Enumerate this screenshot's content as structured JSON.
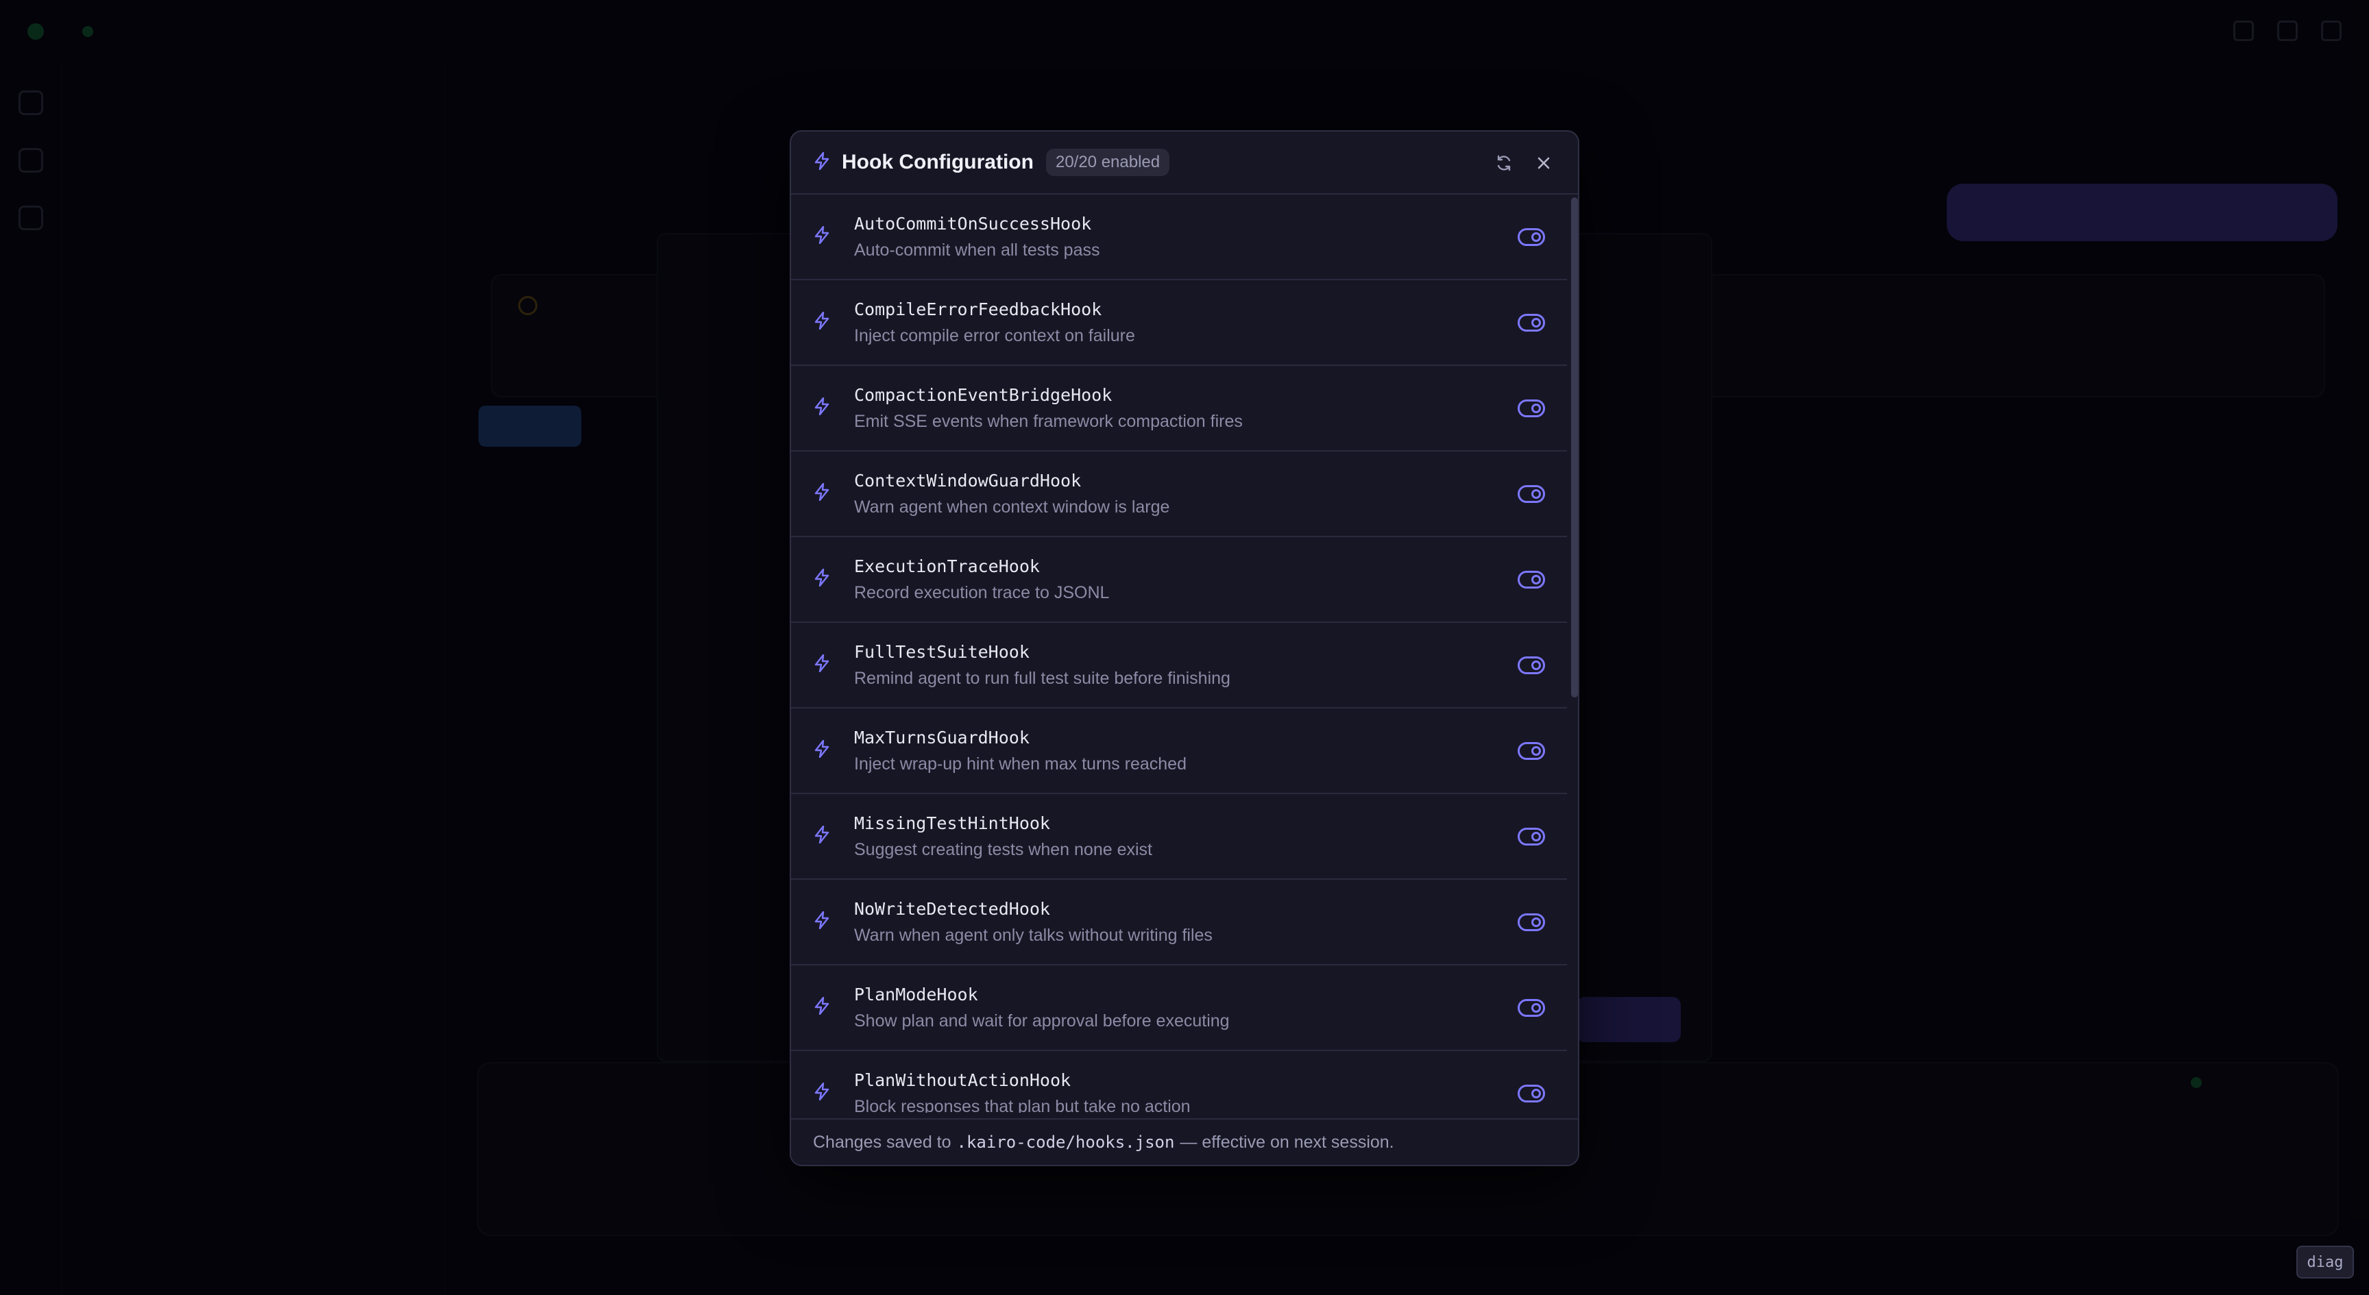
{
  "background": {
    "app_name": "",
    "explorer_title": "",
    "files": []
  },
  "modal": {
    "title": "Hook Configuration",
    "count_badge": "20/20 enabled",
    "refresh_icon": "refresh-icon",
    "close_icon": "close-icon",
    "hooks": [
      {
        "name": "AutoCommitOnSuccessHook",
        "description": "Auto-commit when all tests pass",
        "enabled": true
      },
      {
        "name": "CompileErrorFeedbackHook",
        "description": "Inject compile error context on failure",
        "enabled": true
      },
      {
        "name": "CompactionEventBridgeHook",
        "description": "Emit SSE events when framework compaction fires",
        "enabled": true
      },
      {
        "name": "ContextWindowGuardHook",
        "description": "Warn agent when context window is large",
        "enabled": true
      },
      {
        "name": "ExecutionTraceHook",
        "description": "Record execution trace to JSONL",
        "enabled": true
      },
      {
        "name": "FullTestSuiteHook",
        "description": "Remind agent to run full test suite before finishing",
        "enabled": true
      },
      {
        "name": "MaxTurnsGuardHook",
        "description": "Inject wrap-up hint when max turns reached",
        "enabled": true
      },
      {
        "name": "MissingTestHintHook",
        "description": "Suggest creating tests when none exist",
        "enabled": true
      },
      {
        "name": "NoWriteDetectedHook",
        "description": "Warn when agent only talks without writing files",
        "enabled": true
      },
      {
        "name": "PlanModeHook",
        "description": "Show plan and wait for approval before executing",
        "enabled": true
      },
      {
        "name": "PlanWithoutActionHook",
        "description": "Block responses that plan but take no action",
        "enabled": true
      }
    ],
    "footer": {
      "prefix": "Changes saved to",
      "path": ".kairo-code/hooks.json",
      "suffix": "— effective on next session."
    }
  },
  "diag_label": "diag",
  "colors": {
    "accent": "#7c78ff",
    "modal_bg": "#171624",
    "page_bg": "#06060e"
  }
}
